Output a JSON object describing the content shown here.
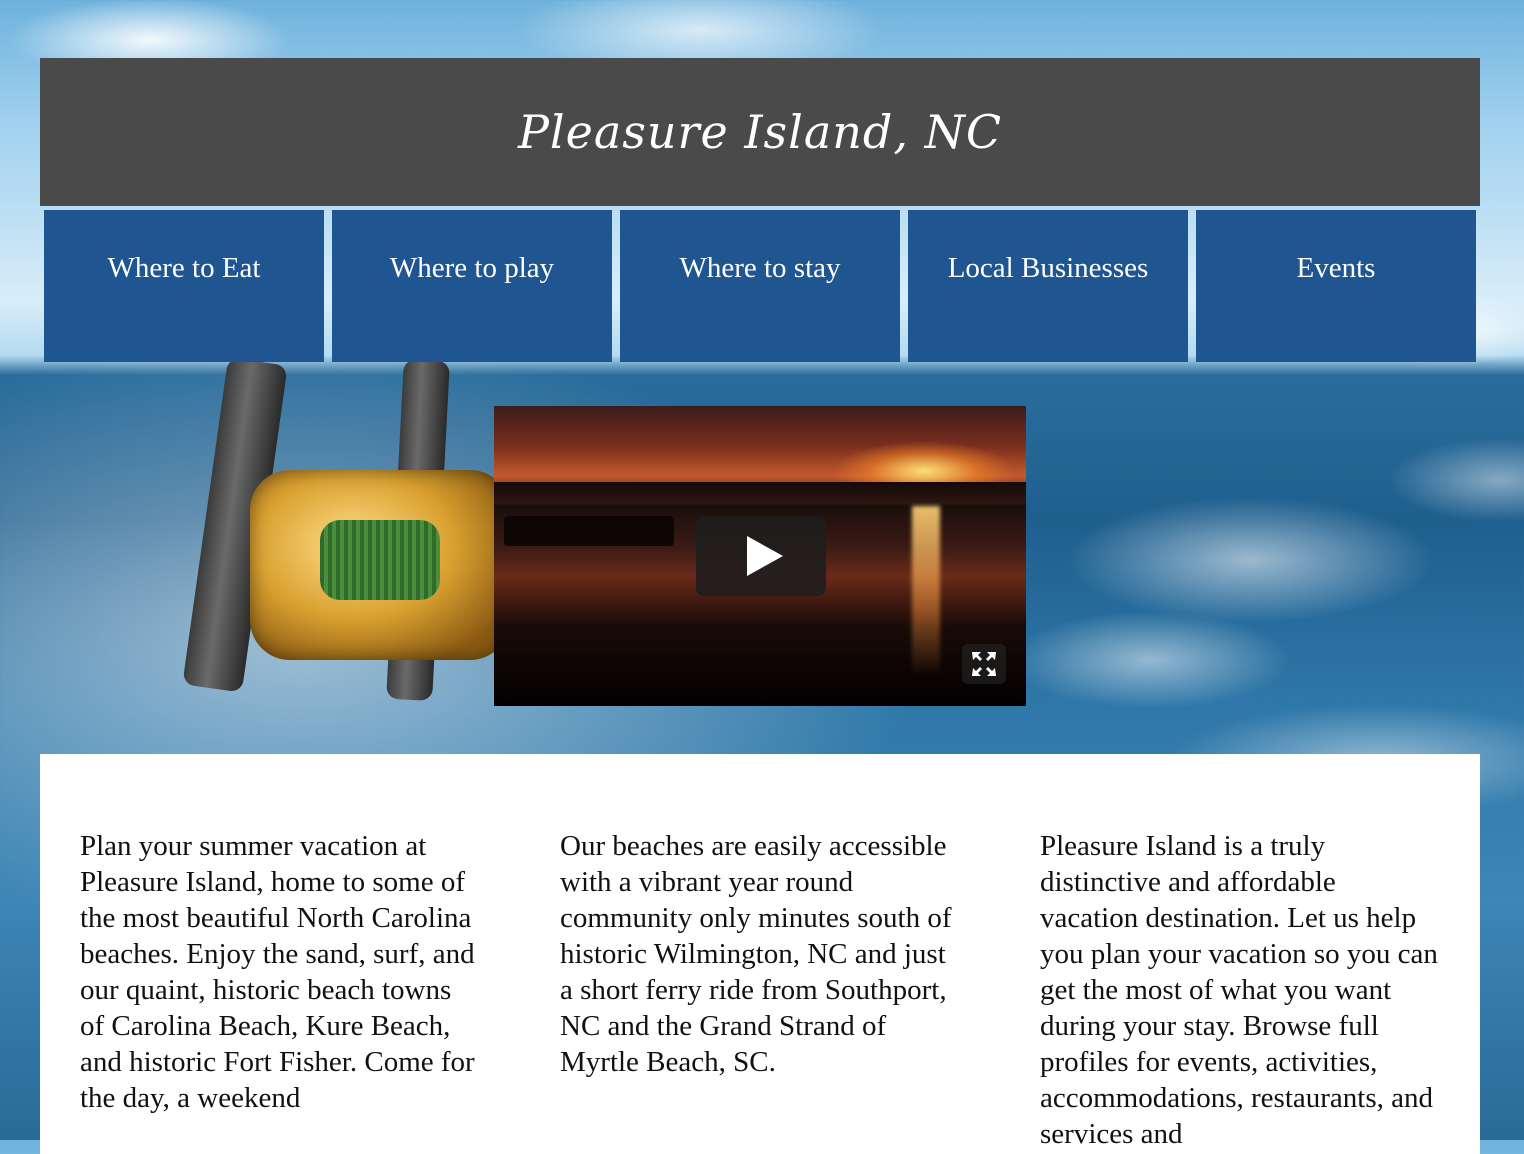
{
  "header": {
    "title": "Pleasure Island, NC"
  },
  "nav": {
    "items": [
      {
        "label": "Where to Eat"
      },
      {
        "label": "Where to play"
      },
      {
        "label": "Where to stay"
      },
      {
        "label": "Local Businesses"
      },
      {
        "label": "Events"
      }
    ]
  },
  "video": {
    "play_icon": "play-icon",
    "fullscreen_icon": "fullscreen-icon"
  },
  "content": {
    "columns": [
      {
        "text": "Plan your summer vacation at Pleasure Island, home to some of the most beautiful North Carolina beaches. Enjoy the sand, surf, and our quaint, historic beach towns of Carolina Beach, Kure Beach, and historic Fort Fisher. Come for the day, a weekend"
      },
      {
        "text": "Our beaches are easily accessible with a vibrant year round community only minutes south of historic Wilmington, NC and just a short ferry ride from Southport, NC and the Grand Strand of Myrtle Beach, SC."
      },
      {
        "text": "Pleasure Island is a truly distinctive and affordable vacation destination. Let us help you plan your vacation so you can get the most of what you want during your stay. Browse full profiles for events, activities, accommodations, restaurants, and services and"
      }
    ]
  },
  "colors": {
    "header_bg": "#4a4a4a",
    "nav_bg": "#1f5591",
    "text": "#111111"
  }
}
